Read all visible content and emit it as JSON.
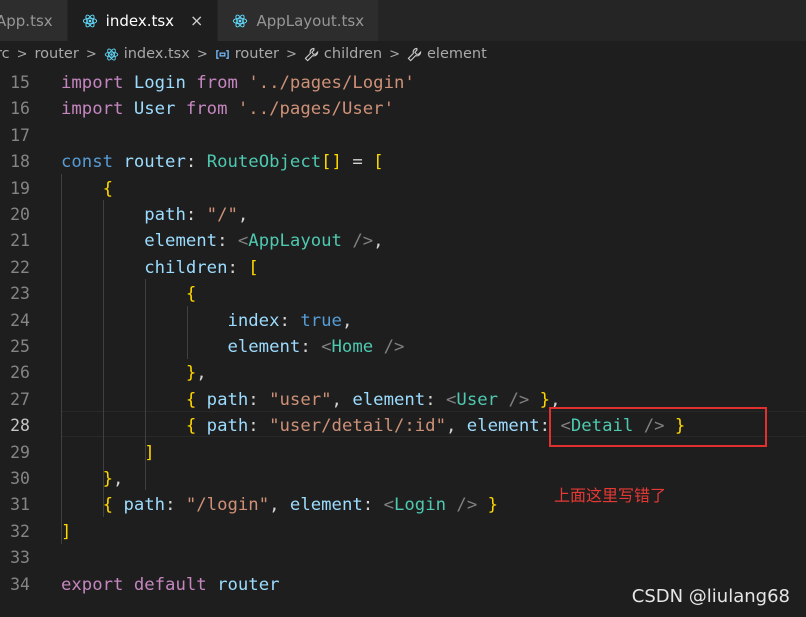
{
  "tabs": [
    {
      "label": "App.tsx",
      "active": false
    },
    {
      "label": "index.tsx",
      "active": true,
      "close": "×"
    },
    {
      "label": "AppLayout.tsx",
      "active": false
    }
  ],
  "breadcrumb": {
    "items": [
      "rc",
      "router",
      "index.tsx",
      "router",
      "children",
      "element"
    ],
    "separator": ">"
  },
  "editor": {
    "current_line": "28",
    "line_numbers": [
      "15",
      "16",
      "17",
      "18",
      "19",
      "20",
      "21",
      "22",
      "23",
      "24",
      "25",
      "26",
      "27",
      "28",
      "29",
      "30",
      "31",
      "32",
      "33",
      "34"
    ],
    "code_lines": [
      "import Login from '../pages/Login'",
      "import User from '../pages/User'",
      "",
      "const router: RouteObject[] = [",
      "    {",
      "        path: \"/\",",
      "        element: <AppLayout />,",
      "        children: [",
      "            {",
      "                index: true,",
      "                element: <Home />",
      "            },",
      "            { path: \"user\", element: <User /> },",
      "            { path: \"user/detail/:id\", element: <Detail /> }",
      "        ]",
      "    },",
      "    { path: \"/login\", element: <Login /> }",
      "]",
      "",
      "export default router"
    ]
  },
  "annotation": {
    "text": "上面这里写错了",
    "color": "#e03030"
  },
  "watermark": "CSDN @liulang68",
  "colors": {
    "background": "#1e1e1e",
    "keyword": "#c586c0",
    "storage": "#569cd6",
    "variable": "#9cdcfe",
    "type": "#4ec9b0",
    "string": "#ce9178",
    "react_icon": "#61dafb"
  }
}
